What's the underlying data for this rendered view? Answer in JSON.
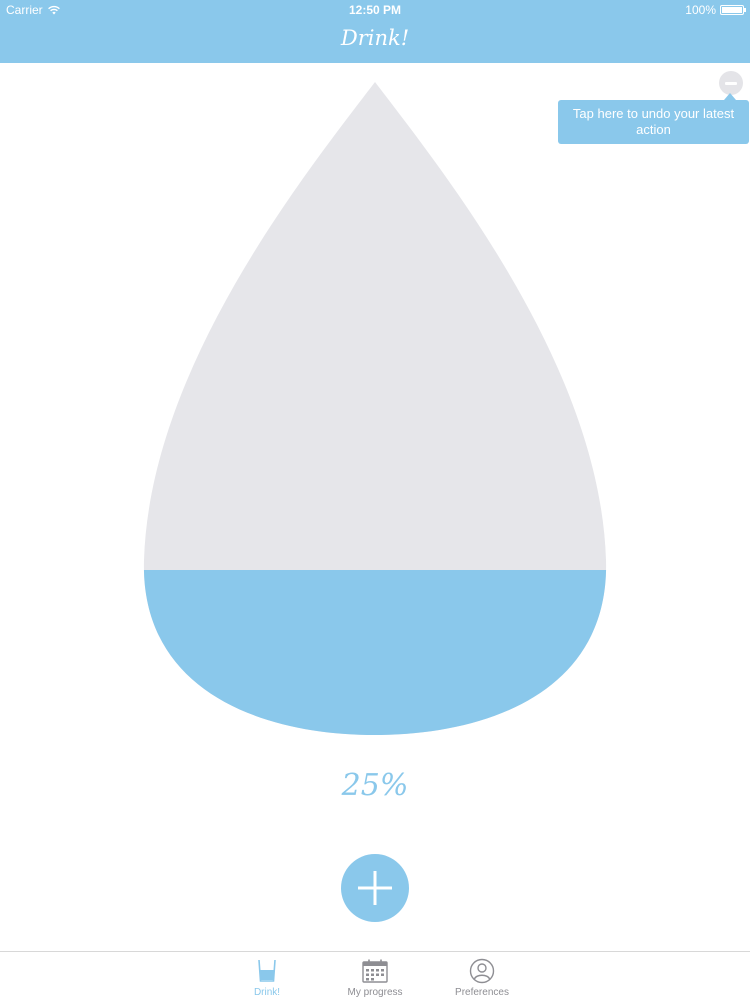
{
  "status_bar": {
    "carrier": "Carrier",
    "time": "12:50 PM",
    "battery": "100%"
  },
  "nav": {
    "title": "Drink!"
  },
  "undo": {
    "icon": "minus-circle-icon",
    "tooltip": "Tap here to undo your latest action"
  },
  "progress": {
    "fill_fraction": 0.25,
    "label": "25%"
  },
  "add_button": {
    "icon": "plus-icon"
  },
  "tabs": [
    {
      "label": "Drink!",
      "icon": "glass-icon",
      "active": true
    },
    {
      "label": "My progress",
      "icon": "calendar-icon",
      "active": false
    },
    {
      "label": "Preferences",
      "icon": "user-icon",
      "active": false
    }
  ],
  "colors": {
    "accent": "#8ac8eb",
    "drop_empty": "#e6e6ea",
    "drop_fill": "#8ac8eb",
    "tab_inactive": "#8e8e93"
  }
}
